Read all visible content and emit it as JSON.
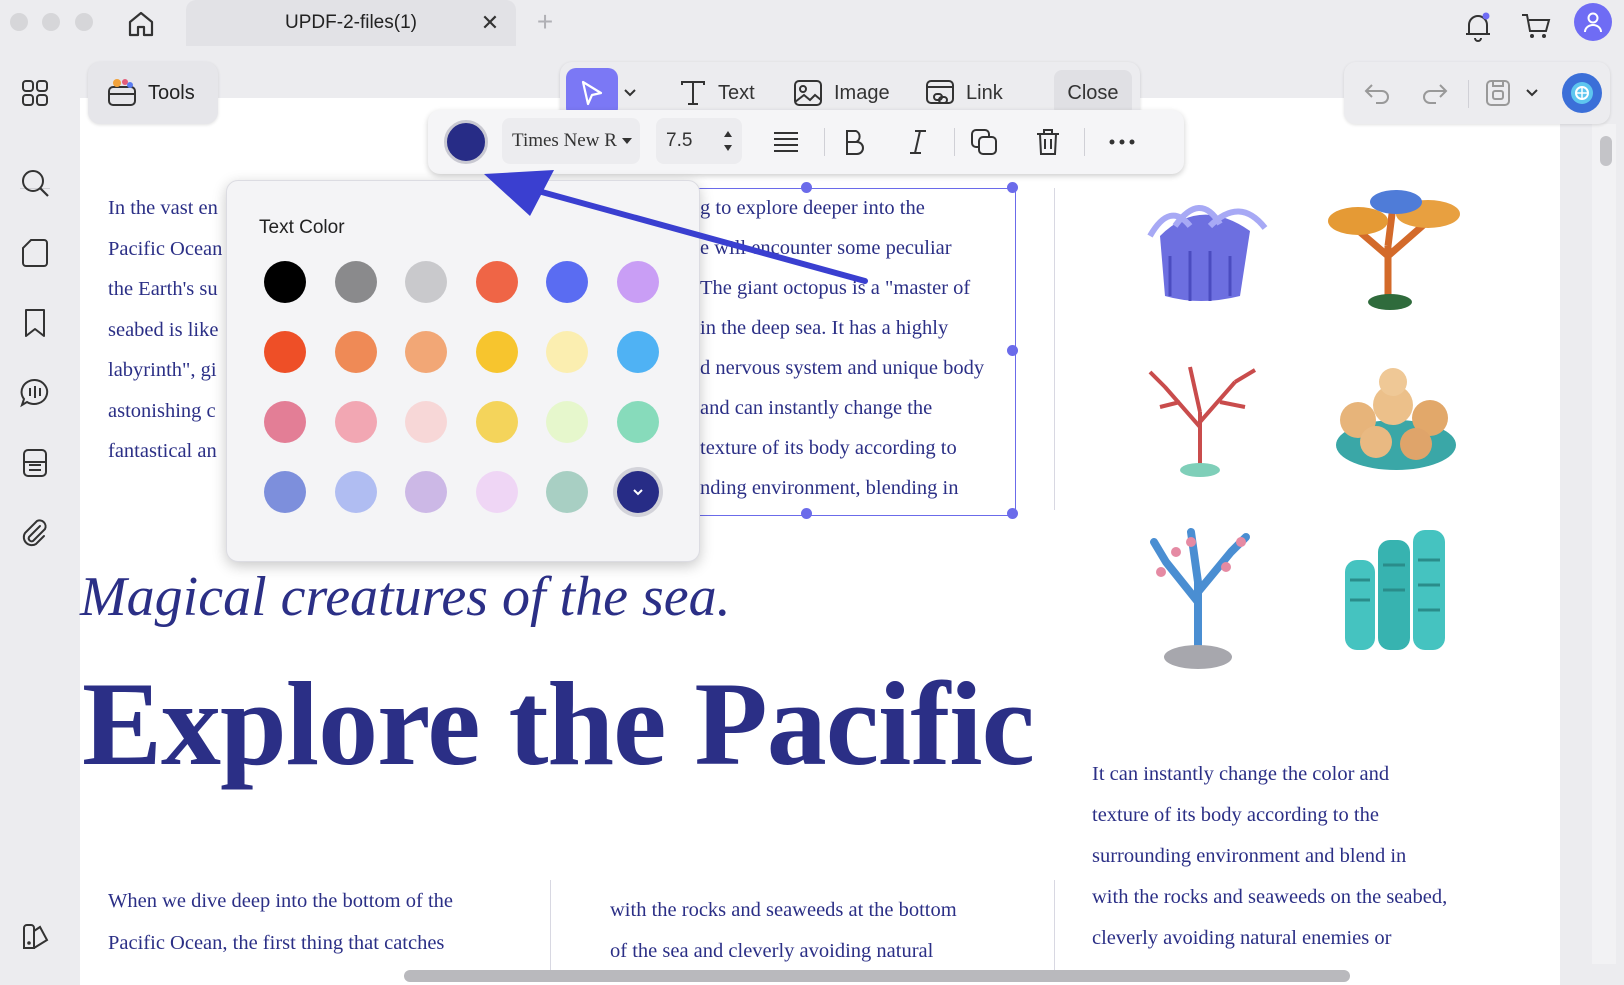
{
  "window": {
    "tab_title": "UPDF-2-files(1)",
    "tab_close": "✕",
    "tab_add": "+"
  },
  "toolbar": {
    "tools_label": "Tools",
    "text_label": "Text",
    "image_label": "Image",
    "link_label": "Link",
    "close_label": "Close"
  },
  "format_bar": {
    "current_color": "#272c86",
    "font_name": "Times New R",
    "font_size": "7.5"
  },
  "color_popup": {
    "title": "Text Color",
    "swatches": [
      [
        "#000000",
        "#8a8a8c",
        "#c9c9cc",
        "#ef6546",
        "#5a6cf2",
        "#c99ef5"
      ],
      [
        "#ee4f27",
        "#ef8a56",
        "#f2a776",
        "#f7c52e",
        "#fbeeb0",
        "#4fb2f4"
      ],
      [
        "#e37e96",
        "#f2a7b3",
        "#f7d7d7",
        "#f4d45b",
        "#e6f7cc",
        "#87dbbb"
      ],
      [
        "#7d8fdc",
        "#b0bdf2",
        "#ccb8e6",
        "#efd6f5",
        "#a8cfc3",
        "#272c86"
      ]
    ]
  },
  "document": {
    "col1_lines": [
      "In the vast en",
      "Pacific Ocean",
      "the Earth's su",
      "seabed is like",
      "labyrinth\", gi",
      "astonishing c",
      "fantastical an"
    ],
    "col2_lines": [
      "g to explore deeper into the",
      "e will encounter some peculiar",
      "The giant octopus is a \"master of",
      "in the deep sea. It has a highly",
      "d nervous system and unique body",
      "and can instantly change the",
      "texture of its body according to",
      "nding environment, blending in"
    ],
    "subtitle": "Magical creatures of the sea.",
    "title": "Explore the Pacific",
    "right_col_lines": [
      "It can instantly change the color and",
      "texture of its body according to the",
      "surrounding environment and blend in",
      "with the rocks and seaweeds on the seabed,",
      "cleverly avoiding natural enemies or"
    ],
    "bottom_col1_lines": [
      "When we dive deep into the bottom of the",
      "Pacific Ocean, the first thing that catches"
    ],
    "bottom_col2_lines": [
      "with the rocks and seaweeds at the bottom",
      "of the sea and cleverly avoiding natural"
    ]
  }
}
